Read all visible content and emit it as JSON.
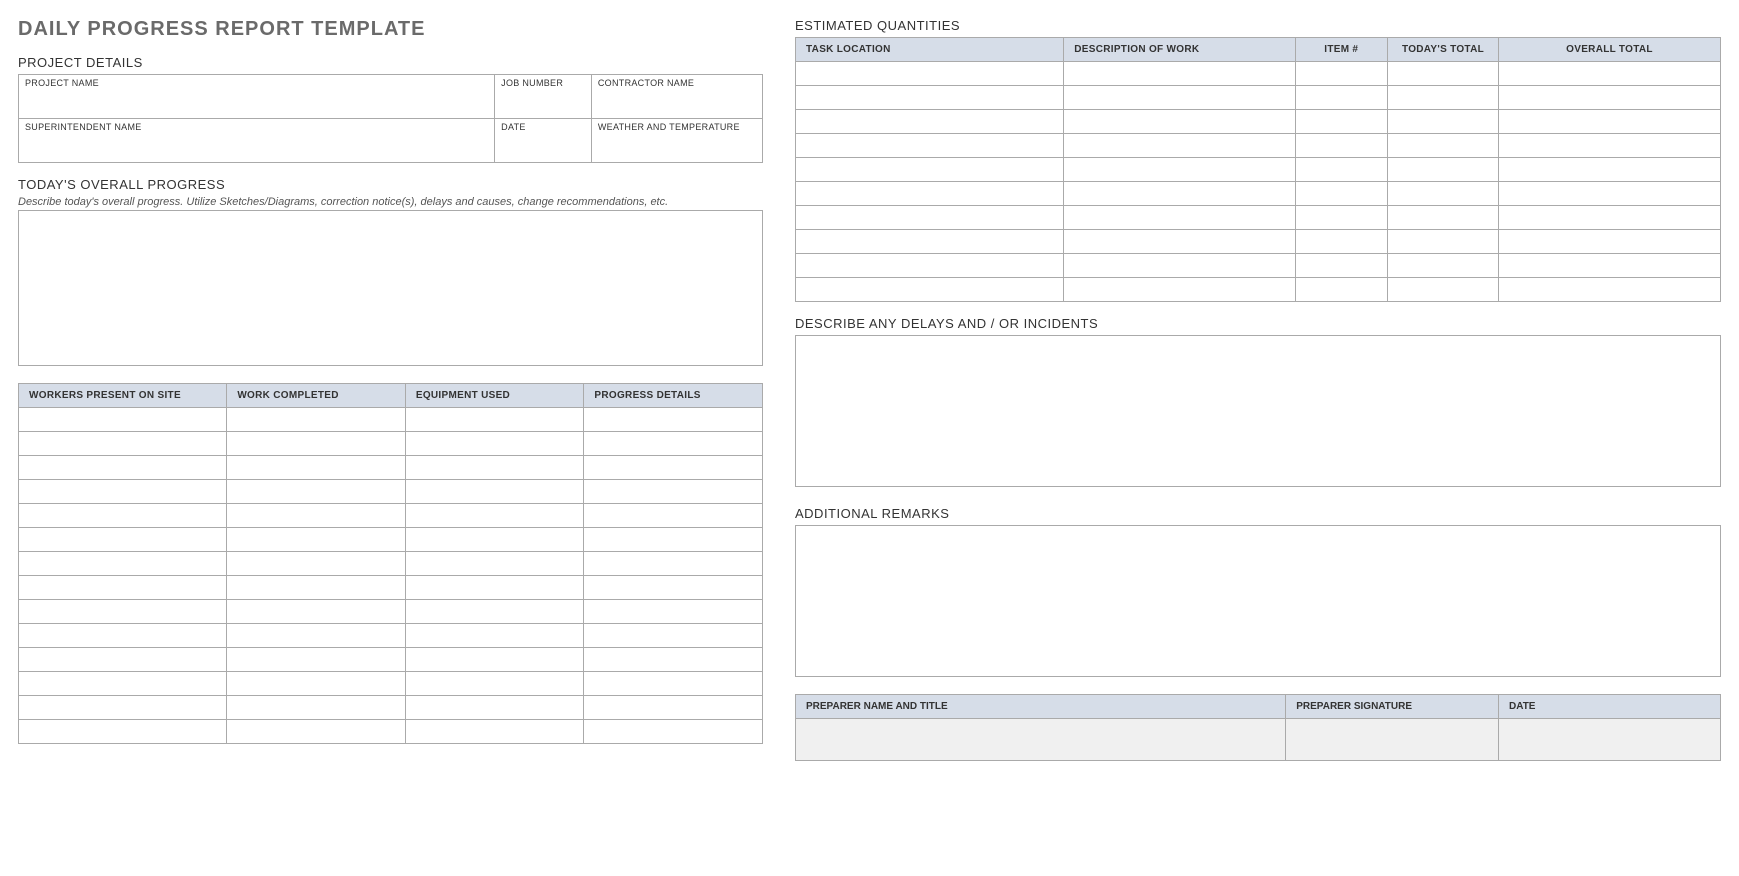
{
  "title": "DAILY PROGRESS REPORT TEMPLATE",
  "project_details": {
    "heading": "PROJECT DETAILS",
    "labels": {
      "project_name": "PROJECT NAME",
      "job_number": "JOB NUMBER",
      "contractor_name": "CONTRACTOR NAME",
      "superintendent_name": "SUPERINTENDENT NAME",
      "date": "DATE",
      "weather": "WEATHER AND TEMPERATURE"
    },
    "values": {
      "project_name": "",
      "job_number": "",
      "contractor_name": "",
      "superintendent_name": "",
      "date": "",
      "weather": ""
    }
  },
  "today_progress": {
    "heading": "TODAY'S OVERALL PROGRESS",
    "desc": "Describe today's overall progress.  Utilize Sketches/Diagrams, correction notice(s), delays and causes, change recommendations, etc.",
    "value": ""
  },
  "work_table": {
    "headers": {
      "workers": "WORKERS PRESENT ON SITE",
      "completed": "WORK COMPLETED",
      "equipment": "EQUIPMENT USED",
      "details": "PROGRESS DETAILS"
    },
    "rows": 14
  },
  "est_qty": {
    "heading": "ESTIMATED QUANTITIES",
    "headers": {
      "task_location": "TASK LOCATION",
      "desc_work": "DESCRIPTION OF WORK",
      "item_no": "ITEM #",
      "today_total": "TODAY'S TOTAL",
      "overall_total": "OVERALL TOTAL"
    },
    "rows": 10
  },
  "delays": {
    "heading": "DESCRIBE ANY DELAYS AND / OR INCIDENTS",
    "value": ""
  },
  "remarks": {
    "heading": "ADDITIONAL REMARKS",
    "value": ""
  },
  "footer": {
    "headers": {
      "preparer": "PREPARER NAME AND TITLE",
      "signature": "PREPARER SIGNATURE",
      "date": "DATE"
    },
    "values": {
      "preparer": "",
      "signature": "",
      "date": ""
    }
  }
}
